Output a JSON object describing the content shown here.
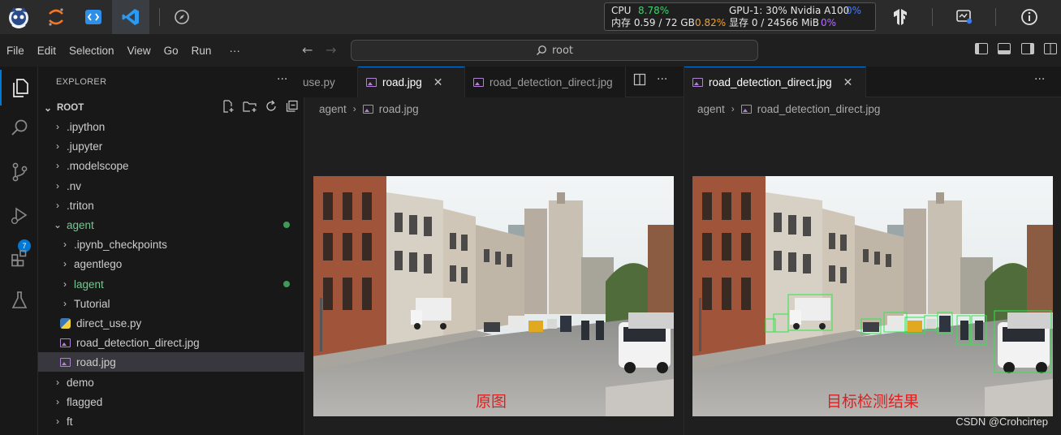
{
  "hostbar": {
    "sysmon": {
      "cpu_label": "CPU",
      "cpu_value": "8.78%",
      "gpu_label": "GPU-1: 30% Nvidia A100",
      "gpu_value": "0%",
      "mem_label": "内存 0.59 / 72 GB",
      "mem_value": "0.82%",
      "vram_label": "显存 0 / 24566 MiB",
      "vram_value": "0%"
    }
  },
  "menubar": {
    "items": [
      "File",
      "Edit",
      "Selection",
      "View",
      "Go",
      "Run"
    ],
    "more": "···",
    "search": "root"
  },
  "activity": {
    "scm_badge": "7"
  },
  "explorer": {
    "title": "EXPLORER",
    "more": "···",
    "root": "ROOT",
    "items": [
      ".ipython",
      ".jupyter",
      ".modelscope",
      ".nv",
      ".triton",
      "agent",
      ".ipynb_checkpoints",
      "agentlego",
      "lagent",
      "Tutorial",
      "direct_use.py",
      "road_detection_direct.jpg",
      "road.jpg",
      "demo",
      "flagged",
      "ft"
    ]
  },
  "group1": {
    "tabs": [
      "use.py",
      "road.jpg",
      "road_detection_direct.jpg"
    ],
    "more": "···",
    "breadcrumb": [
      "agent",
      "road.jpg"
    ],
    "caption": "原图"
  },
  "group2": {
    "tabs": [
      "road_detection_direct.jpg"
    ],
    "more": "···",
    "breadcrumb": [
      "agent",
      "road_detection_direct.jpg"
    ],
    "caption": "目标检测结果"
  },
  "watermark": "CSDN @Crohcirtep",
  "colors": {
    "accent": "#0078d4",
    "git_added": "#73c991",
    "caption_red": "#e02020"
  }
}
